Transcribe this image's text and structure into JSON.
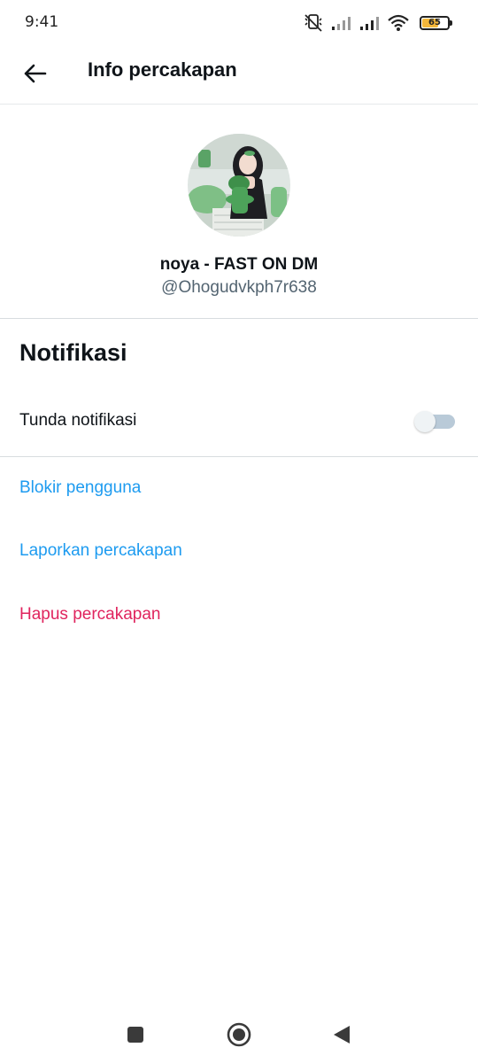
{
  "status_bar": {
    "time": "9:41",
    "battery_level": "65",
    "battery_fraction": 0.65,
    "battery_color": "#f4b73b",
    "icons": [
      "silent-mode-icon",
      "signal-icon",
      "signal-icon",
      "wifi-icon",
      "battery-icon"
    ]
  },
  "header": {
    "title": "Info percakapan",
    "back_icon": "arrow-left-icon"
  },
  "profile": {
    "display_name": "noya - FAST ON DM",
    "handle": "@Ohogudvkph7r638"
  },
  "notifications": {
    "heading": "Notifikasi",
    "snooze_label": "Tunda notifikasi",
    "snooze_enabled": false
  },
  "actions": {
    "block": "Blokir pengguna",
    "report": "Laporkan percakapan",
    "delete": "Hapus percakapan"
  },
  "colors": {
    "link_blue": "#1d9bf0",
    "danger_red": "#e0245e"
  },
  "nav_bar": {
    "icons": [
      "recents-square-icon",
      "home-circle-icon",
      "back-triangle-icon"
    ]
  }
}
